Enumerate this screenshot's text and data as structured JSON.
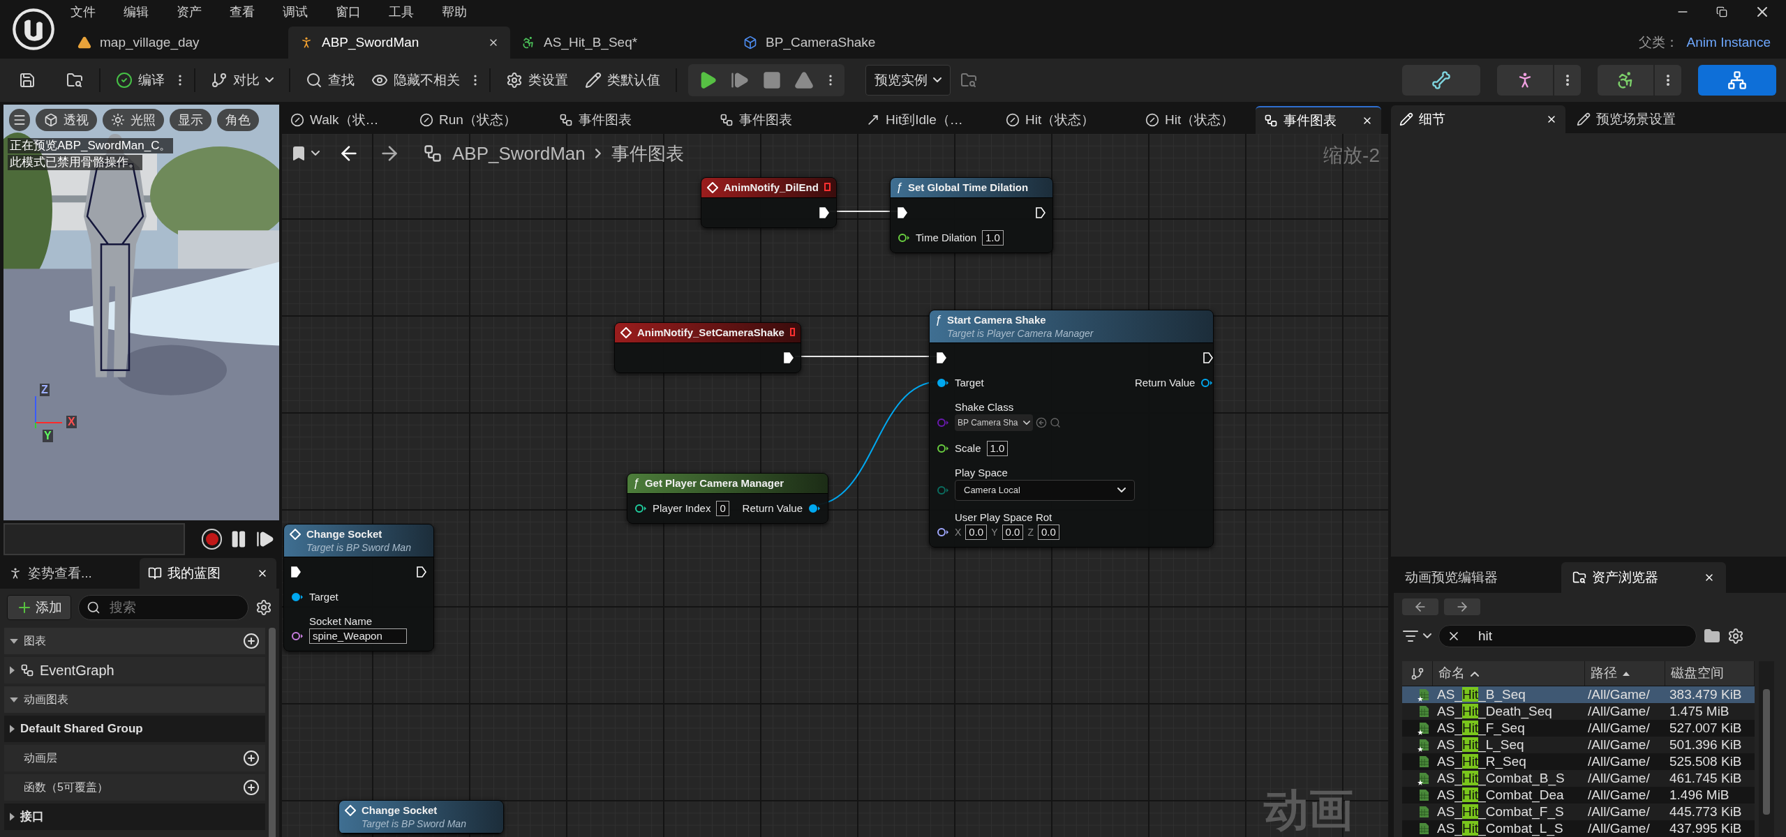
{
  "app_menu": [
    "文件",
    "编辑",
    "资产",
    "查看",
    "调试",
    "窗口",
    "工具",
    "帮助"
  ],
  "documents": [
    {
      "label": "map_village_day",
      "kind": "map",
      "selected": false
    },
    {
      "label": "ABP_SwordMan",
      "kind": "anim_blueprint",
      "selected": true
    },
    {
      "label": "AS_Hit_B_Seq*",
      "kind": "anim_sequence",
      "selected": false
    },
    {
      "label": "BP_CameraShake",
      "kind": "blueprint",
      "selected": false
    }
  ],
  "parent_class": {
    "label": "父类：",
    "value": "Anim Instance"
  },
  "toolbar": {
    "compile": "编译",
    "diff": "对比",
    "find": "查找",
    "hide_unrelated": "隐藏不相关",
    "class_settings": "类设置",
    "class_defaults": "类默认值",
    "preview_instance": "预览实例"
  },
  "sim_controls": [
    {
      "kind": "play",
      "disabled": false
    },
    {
      "kind": "step",
      "disabled": true
    },
    {
      "kind": "stop",
      "disabled": true
    },
    {
      "kind": "eject",
      "disabled": true
    }
  ],
  "modes": [
    {
      "kind": "skeleton",
      "selected": false,
      "menu": false
    },
    {
      "kind": "mesh",
      "selected": false,
      "menu": true
    },
    {
      "kind": "animation",
      "selected": false,
      "menu": true
    },
    {
      "kind": "blueprint",
      "selected": true,
      "menu": false
    }
  ],
  "viewport": {
    "buttons": [
      {
        "label": "透视",
        "kind": "perspective"
      },
      {
        "label": "光照",
        "kind": "lit"
      },
      {
        "label": "显示",
        "kind": "text"
      },
      {
        "label": "角色",
        "kind": "text"
      }
    ],
    "notice": [
      "正在预览ABP_SwordMan_C。",
      "此模式已禁用骨骼操作。"
    ],
    "axes": [
      "Z",
      "Y",
      "X"
    ]
  },
  "left_tabs": [
    {
      "label": "姿势查看...",
      "kind": "pose",
      "selected": false
    },
    {
      "label": "我的蓝图",
      "kind": "blueprint",
      "selected": true
    }
  ],
  "my_blueprint": {
    "add": "添加",
    "search_placeholder": "搜索",
    "sections": [
      {
        "kind": "header",
        "label": "图表",
        "expanded": true,
        "add": true
      },
      {
        "kind": "item",
        "label": "EventGraph",
        "expanded": false,
        "add": false
      },
      {
        "kind": "header",
        "label": "动画图表",
        "expanded": true,
        "add": false
      },
      {
        "kind": "group",
        "label": "Default Shared Group",
        "expanded": false,
        "add": false
      },
      {
        "kind": "category",
        "label": "动画层",
        "expanded": false,
        "add": true
      },
      {
        "kind": "category",
        "label": "函数（5可覆盖）",
        "expanded": false,
        "add": true
      },
      {
        "kind": "group",
        "label": "接口",
        "expanded": false,
        "add": false
      }
    ]
  },
  "graph_tabs": [
    {
      "label": "Walk（状…",
      "kind": "state",
      "selected": false
    },
    {
      "label": "Run（状态）",
      "kind": "state",
      "selected": false
    },
    {
      "label": "事件图表",
      "kind": "graph",
      "selected": false
    },
    {
      "label": "事件图表",
      "kind": "graph",
      "selected": false
    },
    {
      "label": "Hit到Idle（…",
      "kind": "transition",
      "selected": false
    },
    {
      "label": "Hit（状态）",
      "kind": "state",
      "selected": false
    },
    {
      "label": "Hit（状态）",
      "kind": "state",
      "selected": false
    },
    {
      "label": "事件图表",
      "kind": "graph",
      "selected": true
    }
  ],
  "breadcrumb": [
    "ABP_SwordMan",
    "事件图表"
  ],
  "zoom": "缩放-2",
  "graph_type": "动画",
  "nodes": [
    {
      "kind": "event",
      "title": "AnimNotify_DilEnd",
      "outputs": [
        {
          "kind": "exec",
          "connected": true
        }
      ]
    },
    {
      "kind": "function",
      "icon": "ƒ",
      "title": "Set Global Time Dilation",
      "inputs": [
        {
          "kind": "exec",
          "connected": true
        },
        {
          "kind": "float",
          "label": "Time Dilation",
          "value": "1.0",
          "connected": false
        }
      ],
      "outputs": [
        {
          "kind": "exec",
          "connected": false
        }
      ]
    },
    {
      "kind": "event",
      "title": "AnimNotify_SetCameraShake",
      "outputs": [
        {
          "kind": "exec",
          "connected": true
        }
      ]
    },
    {
      "kind": "function",
      "icon": "ƒ",
      "title": "Start Camera Shake",
      "subtitle": "Target is Player Camera Manager",
      "inputs": [
        {
          "kind": "exec",
          "connected": true
        },
        {
          "kind": "object",
          "label": "Target",
          "connected": true
        },
        {
          "kind": "class",
          "label": "Shake Class",
          "value": "BP Camera Sha",
          "connected": false
        },
        {
          "kind": "float",
          "label": "Scale",
          "value": "1.0",
          "connected": false
        },
        {
          "kind": "enum",
          "label": "Play Space",
          "value": "Camera Local",
          "connected": false
        },
        {
          "kind": "rotator",
          "label": "User Play Space Rot",
          "values": [
            {
              "axis": "X",
              "value": "0.0"
            },
            {
              "axis": "Y",
              "value": "0.0"
            },
            {
              "axis": "Z",
              "value": "0.0"
            }
          ],
          "connected": false
        }
      ],
      "outputs": [
        {
          "kind": "exec",
          "connected": false
        },
        {
          "kind": "object",
          "label": "Return Value",
          "connected": false
        }
      ]
    },
    {
      "kind": "pure",
      "icon": "ƒ",
      "title": "Get Player Camera Manager",
      "inputs": [
        {
          "kind": "int",
          "label": "Player Index",
          "value": "0",
          "connected": false
        }
      ],
      "outputs": [
        {
          "kind": "object",
          "label": "Return Value",
          "connected": true
        }
      ]
    },
    {
      "kind": "function",
      "title": "Change Socket",
      "subtitle": "Target is BP Sword Man",
      "inputs": [
        {
          "kind": "exec",
          "connected": true
        },
        {
          "kind": "object",
          "label": "Target",
          "connected": true
        },
        {
          "kind": "name",
          "label": "Socket Name",
          "value": "spine_Weapon",
          "connected": false
        }
      ],
      "outputs": [
        {
          "kind": "exec",
          "connected": false
        }
      ]
    },
    {
      "kind": "function",
      "title": "Change Socket",
      "subtitle": "Target is BP Sword Man"
    }
  ],
  "right_tabs": [
    {
      "label": "细节",
      "selected": true
    },
    {
      "label": "预览场景设置",
      "selected": false
    }
  ],
  "bottom_tabs": [
    {
      "label": "动画预览编辑器",
      "selected": false
    },
    {
      "label": "资产浏览器",
      "selected": true
    }
  ],
  "asset_browser": {
    "search": "hit",
    "columns": [
      {
        "label": "命名",
        "kind": "name_sort"
      },
      {
        "label": "路径",
        "kind": "ascending"
      },
      {
        "label": "磁盘空间",
        "kind": "plain"
      }
    ],
    "rows": [
      {
        "name": {
          "before": "AS_",
          "match": "Hit",
          "after": "_B_Seq"
        },
        "path": "/All/Game/",
        "size": "383.479 KiB",
        "starred": true,
        "selected": true
      },
      {
        "name": {
          "before": "AS_",
          "match": "Hit",
          "after": "_Death_Seq"
        },
        "path": "/All/Game/",
        "size": "1.475 MiB",
        "starred": false,
        "selected": false
      },
      {
        "name": {
          "before": "AS_",
          "match": "Hit",
          "after": "_F_Seq"
        },
        "path": "/All/Game/",
        "size": "527.007 KiB",
        "starred": true,
        "selected": false
      },
      {
        "name": {
          "before": "AS_",
          "match": "Hit",
          "after": "_L_Seq"
        },
        "path": "/All/Game/",
        "size": "501.396 KiB",
        "starred": true,
        "selected": false
      },
      {
        "name": {
          "before": "AS_",
          "match": "Hit",
          "after": "_R_Seq"
        },
        "path": "/All/Game/",
        "size": "525.508 KiB",
        "starred": false,
        "selected": false
      },
      {
        "name": {
          "before": "AS_",
          "match": "Hit",
          "after": "_Combat_B_S"
        },
        "path": "/All/Game/",
        "size": "461.745 KiB",
        "starred": true,
        "selected": false
      },
      {
        "name": {
          "before": "AS_",
          "match": "Hit",
          "after": "_Combat_Dea"
        },
        "path": "/All/Game/",
        "size": "1.496 MiB",
        "starred": false,
        "selected": false
      },
      {
        "name": {
          "before": "AS_",
          "match": "Hit",
          "after": "_Combat_F_S"
        },
        "path": "/All/Game/",
        "size": "445.773 KiB",
        "starred": false,
        "selected": false
      },
      {
        "name": {
          "before": "AS_",
          "match": "Hit",
          "after": "_Combat_L_S"
        },
        "path": "/All/Game/",
        "size": "437.995 KiB",
        "starred": false,
        "selected": false
      }
    ]
  }
}
